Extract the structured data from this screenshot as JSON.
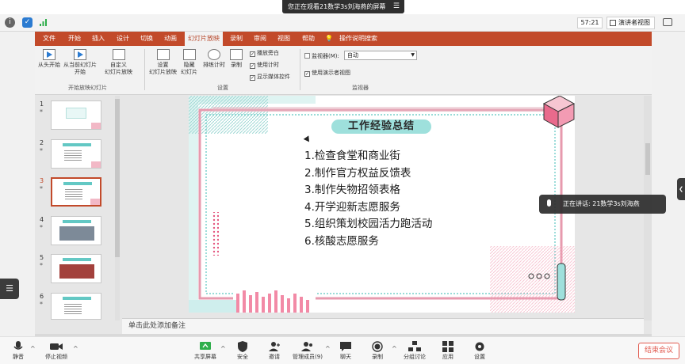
{
  "share_banner": {
    "text": "您正在观看21数学3s刘海燕的屏幕"
  },
  "meeting_bar": {
    "timer": "57:21",
    "view_label": "演讲者视图",
    "icons": [
      "info-icon",
      "shield-icon",
      "signal-icon",
      "chat-icon"
    ]
  },
  "ppt": {
    "menu": [
      "文件",
      "开始",
      "插入",
      "设计",
      "切换",
      "动画",
      "幻灯片放映",
      "录制",
      "审阅",
      "视图",
      "帮助",
      "操作说明搜索"
    ],
    "active_menu": "幻灯片放映",
    "ribbon": {
      "from_start": "从头开始",
      "from_current_1": "从当前幻灯片",
      "from_current_2": "开始",
      "custom_1": "自定义",
      "custom_2": "幻灯片放映",
      "group_start": "开始放映幻灯片",
      "setup_1": "设置",
      "setup_2": "幻灯片放映",
      "hide_1": "隐藏",
      "hide_2": "幻灯片",
      "rehearse": "排练计时",
      "record": "录制",
      "chk_narration": "播放旁白",
      "chk_timing": "使用计时",
      "chk_media": "显示媒体控件",
      "group_setup": "设置",
      "monitor_label": "监视器(M):",
      "monitor_value": "自动",
      "chk_presenter": "使用演示者视图",
      "group_monitor": "监视器"
    },
    "thumbnails": [
      {
        "num": "1",
        "star": "*"
      },
      {
        "num": "2",
        "star": "*"
      },
      {
        "num": "3",
        "star": "*"
      },
      {
        "num": "4",
        "star": "*"
      },
      {
        "num": "5",
        "star": "*"
      },
      {
        "num": "6",
        "star": "*"
      }
    ],
    "selected_slide": 3,
    "slide": {
      "title": "工作经验总结",
      "items": [
        "1.检查食堂和商业街",
        "2.制作官方权益反馈表",
        "3.制作失物招领表格",
        "4.开学迎新志愿服务",
        "5.组织策划校园活力跑活动",
        "6.核酸志愿服务"
      ]
    },
    "notes_placeholder": "单击此处添加备注"
  },
  "speaking": {
    "text": "正在讲话: 21数学3s刘海燕"
  },
  "toolbar": {
    "mute": "静音",
    "stop_video": "停止视频",
    "share": "共享屏幕",
    "security": "安全",
    "invite": "邀请",
    "members": "管理成员(9)",
    "chat": "聊天",
    "record": "录制",
    "breakout": "分组讨论",
    "apps": "应用",
    "settings": "设置",
    "end": "结束会议"
  },
  "colors": {
    "ppt_accent": "#c24a2a",
    "slide_teal": "#63c8c4",
    "slide_pink": "#f0a0b8",
    "end_red": "#e15a4f"
  }
}
